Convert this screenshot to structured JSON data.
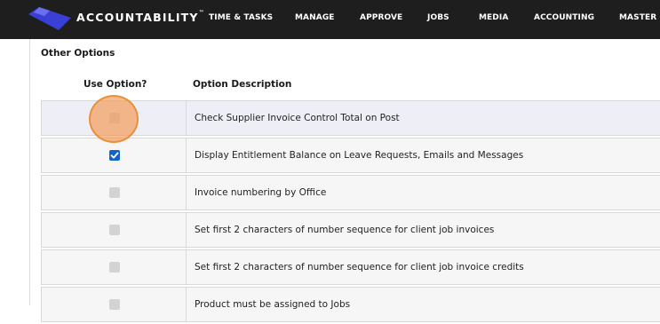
{
  "header": {
    "logo_text": "ACCOUNTABILITY",
    "logo_tm": "™",
    "nav": [
      "TIME & TASKS",
      "MANAGE",
      "APPROVE",
      "JOBS",
      "MEDIA",
      "ACCOUNTING",
      "MASTER F"
    ]
  },
  "section": {
    "title": "Other Options",
    "col_use": "Use Option?",
    "col_desc": "Option Description"
  },
  "options": [
    {
      "description": "Check Supplier Invoice Control Total on Post",
      "checked": false
    },
    {
      "description": "Display Entitlement Balance on Leave Requests, Emails and Messages",
      "checked": true
    },
    {
      "description": "Invoice numbering by Office",
      "checked": false
    },
    {
      "description": "Set first 2 characters of number sequence for client job invoices",
      "checked": false
    },
    {
      "description": "Set first 2 characters of number sequence for client job invoice credits",
      "checked": false
    },
    {
      "description": "Product must be assigned to Jobs",
      "checked": false
    }
  ],
  "colors": {
    "header_bg": "#1e1e1e",
    "logo_blue": "#3a3fd6",
    "checkbox_checked": "#1463c8",
    "click_marker": "#f0904a"
  }
}
